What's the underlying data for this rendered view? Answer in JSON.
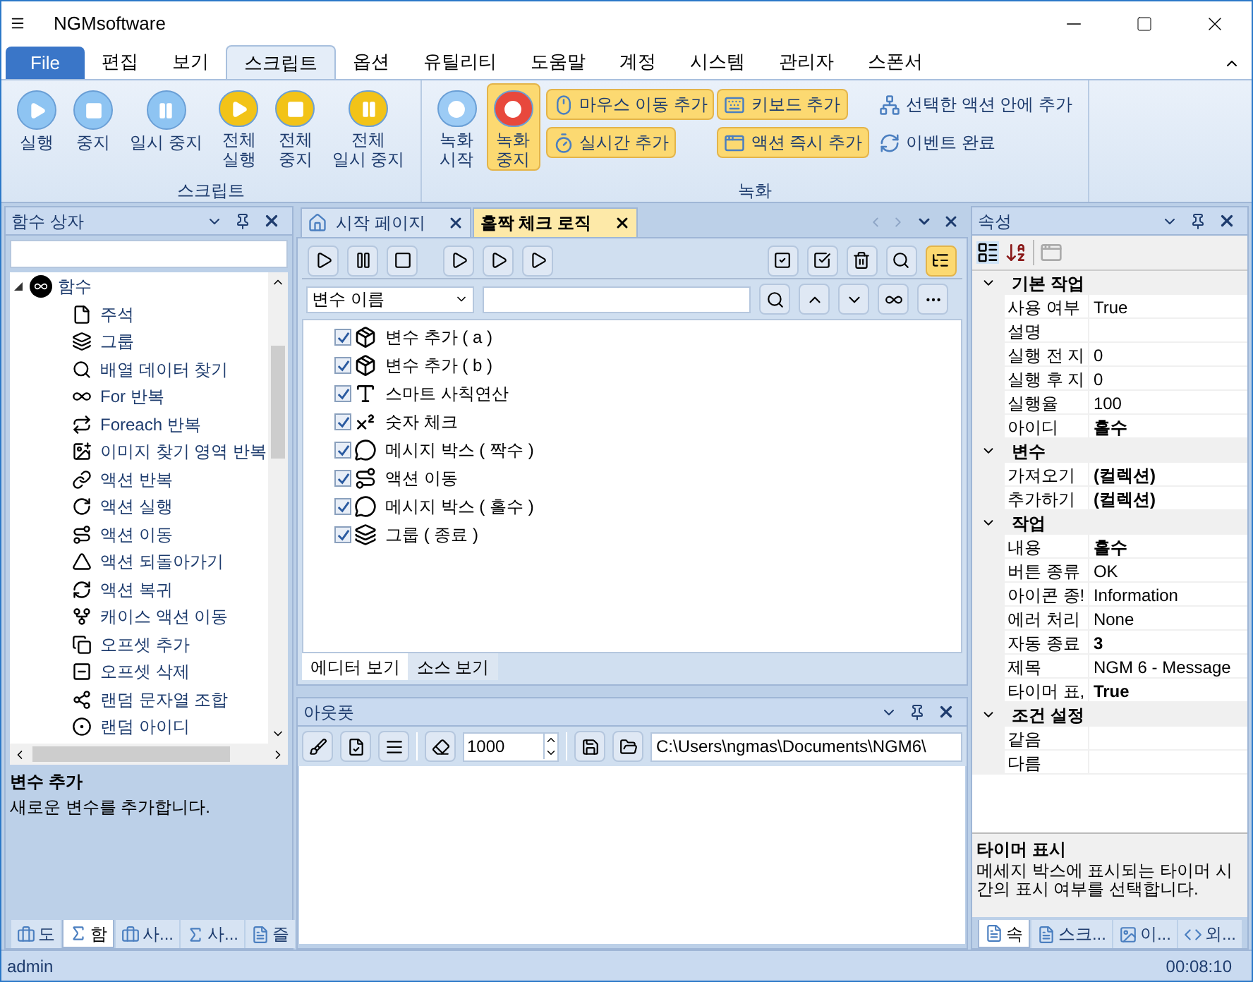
{
  "window": {
    "title": "NGMsoftware"
  },
  "menu_tabs": [
    {
      "label": "File",
      "kind": "file",
      "selected": false
    },
    {
      "label": "편집",
      "kind": "tab",
      "selected": false
    },
    {
      "label": "보기",
      "kind": "tab",
      "selected": false
    },
    {
      "label": "스크립트",
      "kind": "tab",
      "selected": true
    },
    {
      "label": "옵션",
      "kind": "tab",
      "selected": false
    },
    {
      "label": "유틸리티",
      "kind": "tab",
      "selected": false
    },
    {
      "label": "도움말",
      "kind": "tab",
      "selected": false
    },
    {
      "label": "계정",
      "kind": "tab",
      "selected": false
    },
    {
      "label": "시스템",
      "kind": "tab",
      "selected": false
    },
    {
      "label": "관리자",
      "kind": "tab",
      "selected": false
    },
    {
      "label": "스폰서",
      "kind": "tab",
      "selected": false
    }
  ],
  "ribbon_groups": [
    {
      "title": "스크립트",
      "buttons": [
        {
          "lines": [
            "실행"
          ],
          "kind": "play",
          "color": "#8ec4f2",
          "highlighted": false
        },
        {
          "lines": [
            "중지"
          ],
          "kind": "stop",
          "color": "#8ec4f2",
          "highlighted": false
        },
        {
          "lines": [
            "일시 중지"
          ],
          "kind": "pause",
          "color": "#8ec4f2",
          "highlighted": false
        },
        {
          "lines": [
            "전체",
            "실행"
          ],
          "kind": "play",
          "color": "#f2c318",
          "highlighted": false
        },
        {
          "lines": [
            "전체",
            "중지"
          ],
          "kind": "stop",
          "color": "#f2c318",
          "highlighted": false
        },
        {
          "lines": [
            "전체",
            "일시 중지"
          ],
          "kind": "pause",
          "color": "#f2c318",
          "highlighted": false
        }
      ]
    },
    {
      "title": "녹화",
      "buttons": [
        {
          "lines": [
            "녹화",
            "시작"
          ],
          "kind": "record",
          "color": "#9ccbf5",
          "highlighted": false
        },
        {
          "lines": [
            "녹화",
            "중지"
          ],
          "kind": "record",
          "color": "#e8483c",
          "highlighted": true
        }
      ],
      "small_buttons": [
        {
          "label": "마우스 이동 추가",
          "kind": "mouse",
          "highlighted": true
        },
        {
          "label": "키보드 추가",
          "kind": "keyboard",
          "highlighted": true
        },
        {
          "label": "선택한 액션 안에 추가",
          "kind": "tree",
          "highlighted": false
        },
        {
          "label": "실시간 추가",
          "kind": "timer",
          "highlighted": true
        },
        {
          "label": "액션 즉시 추가",
          "kind": "window",
          "highlighted": true
        },
        {
          "label": "이벤트 완료",
          "kind": "refresh",
          "highlighted": false
        }
      ]
    }
  ],
  "function_box": {
    "title": "함수 상자",
    "tree": [
      {
        "label": "함수",
        "expanded": true,
        "children": [
          {
            "label": "주석"
          },
          {
            "label": "그룹"
          },
          {
            "label": "배열 데이터 찾기"
          },
          {
            "label": "For 반복"
          },
          {
            "label": "Foreach 반복"
          },
          {
            "label": "이미지 찾기 영역 반복"
          },
          {
            "label": "액션 반복"
          },
          {
            "label": "액션 실행"
          },
          {
            "label": "액션 이동"
          },
          {
            "label": "액션 되돌아가기"
          },
          {
            "label": "액션 복귀"
          },
          {
            "label": "캐이스 액션 이동"
          },
          {
            "label": "오프셋 추가"
          },
          {
            "label": "오프셋 삭제"
          },
          {
            "label": "랜덤 문자열 조합"
          },
          {
            "label": "랜덤 아이디"
          }
        ]
      }
    ],
    "description_title": "변수 추가",
    "description": "새로운 변수를 추가합니다.",
    "bottom_tabs": [
      {
        "label": "도",
        "selected": false
      },
      {
        "label": "함",
        "selected": true
      },
      {
        "label": "사...",
        "selected": false
      },
      {
        "label": "사...",
        "selected": false
      },
      {
        "label": "즐",
        "selected": false
      }
    ]
  },
  "document_tabs": [
    {
      "label": "시작 페이지",
      "selected": false
    },
    {
      "label": "홀짝 체크 로직",
      "selected": true
    }
  ],
  "editor": {
    "filter_combo": "변수 이름",
    "actions": [
      {
        "label": "변수 추가 ( a )",
        "checked": true
      },
      {
        "label": "변수 추가 ( b )",
        "checked": true
      },
      {
        "label": "스마트 사칙연산",
        "checked": true
      },
      {
        "label": "숫자 체크",
        "checked": true
      },
      {
        "label": "메시지 박스 ( 짝수 )",
        "checked": true
      },
      {
        "label": "액션 이동",
        "checked": true
      },
      {
        "label": "메시지 박스 ( 홀수 )",
        "checked": true
      },
      {
        "label": "그룹 ( 종료 )",
        "checked": true
      }
    ],
    "view_tabs": [
      {
        "label": "에디터 보기",
        "selected": true
      },
      {
        "label": "소스 보기",
        "selected": false
      }
    ]
  },
  "output": {
    "title": "아웃풋",
    "line_limit": "1000",
    "path": "C:\\Users\\ngmas\\Documents\\NGM6\\"
  },
  "properties": {
    "title": "속성",
    "categories": [
      {
        "name": "기본 작업",
        "expanded": true,
        "rows": [
          {
            "name": "사용 여부",
            "value": "True",
            "bold": false
          },
          {
            "name": "설명"
          },
          {
            "name": "실행 전 지",
            "value": "0",
            "bold": false
          },
          {
            "name": "실행 후 지",
            "value": "0",
            "bold": false
          },
          {
            "name": "실행율",
            "value": "100",
            "bold": false
          },
          {
            "name": "아이디",
            "value": "홀수",
            "bold": true
          }
        ]
      },
      {
        "name": "변수",
        "expanded": true,
        "rows": [
          {
            "name": "가져오기",
            "value": "(컬렉션)",
            "bold": true
          },
          {
            "name": "추가하기",
            "value": "(컬렉션)",
            "bold": true
          }
        ]
      },
      {
        "name": "작업",
        "expanded": true,
        "rows": [
          {
            "name": "내용",
            "value": "홀수",
            "bold": true
          },
          {
            "name": "버튼 종류",
            "value": "OK",
            "bold": false
          },
          {
            "name": "아이콘 종!",
            "value": "Information",
            "bold": false
          },
          {
            "name": "에러 처리",
            "value": "None",
            "bold": false
          },
          {
            "name": "자동 종료",
            "value": "3",
            "bold": true
          },
          {
            "name": "제목",
            "value": "NGM 6 - Message",
            "bold": false
          },
          {
            "name": "타이머 표,",
            "value": "True",
            "bold": true
          }
        ]
      },
      {
        "name": "조건 설정",
        "expanded": true,
        "rows": [
          {
            "name": "같음"
          },
          {
            "name": "다름"
          }
        ]
      }
    ],
    "description_title": "타이머 표시",
    "description": "메세지 박스에 표시되는 타이머 시간의 표시 여부를 선택합니다.",
    "bottom_tabs": [
      {
        "label": "속",
        "selected": true
      },
      {
        "label": "스크...",
        "selected": false
      },
      {
        "label": "이...",
        "selected": false
      },
      {
        "label": "외...",
        "selected": false
      }
    ]
  },
  "status_bar": {
    "user": "admin",
    "elapsed": "00:08:10"
  }
}
